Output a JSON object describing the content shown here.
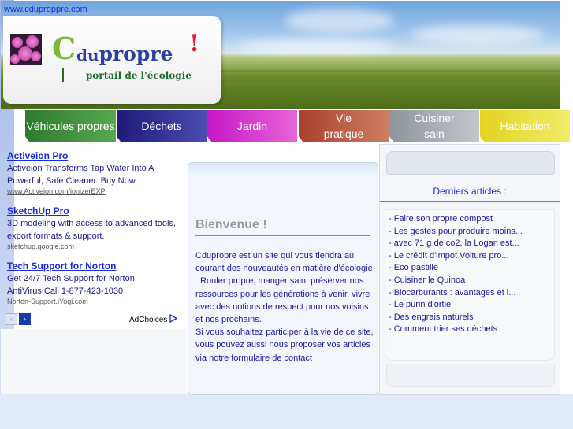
{
  "site_url": "www.cduproppre.com",
  "logo": {
    "c": "C",
    "du": "du",
    "propre": "propre",
    "excl": "!",
    "tagline": "portail de l'écologie"
  },
  "nav": [
    {
      "label": "Véhicules propres",
      "color": "#3a8a3a"
    },
    {
      "label": "Déchets",
      "color": "#2a2a8a"
    },
    {
      "label": "Jardin",
      "color": "#c81fd0"
    },
    {
      "label": "Vie pratique",
      "color": "#b4503a"
    },
    {
      "label": "Cuisiner sain",
      "color": "#9aa0a8"
    },
    {
      "label": "Habitation",
      "color": "#e8dc2a"
    }
  ],
  "ads": [
    {
      "title": "Activeion Pro",
      "text": "Activeion Transforms Tap Water Into A Powerful, Safe Cleaner. Buy Now.",
      "url": "www.Activeion.com/ionizerEXP"
    },
    {
      "title": "SketchUp Pro",
      "text": "3D modeling with access to advanced tools, export formats & support.",
      "url": "sketchup.google.com"
    },
    {
      "title": "Tech Support for Norton",
      "text": "Get 24/7 Tech Support for Norton AntiVirus,Call 1-877-423-1030",
      "url": "Norton-Support.iYogi.com"
    }
  ],
  "ad_choices": "AdChoices",
  "ad_nav": {
    "prev": "‹",
    "next": "›"
  },
  "welcome": {
    "title": "Bienvenue !",
    "intro_1": "Cdupropre est un site qui vous tiendra au courant des nouveautés en matière d'écologie : Rouler propre, manger sain, préserver nos ressources pour les générations à venir, vivre avec des notions de respect pour nos voisins et nos prochains.",
    "intro_2": "Si vous souhaitez participer à la vie de ce site, vous pouvez aussi nous proposer vos articles via notre formulaire de contact"
  },
  "recent": {
    "title": "Derniers articles :",
    "items": [
      "- Faire son propre compost",
      "- Les gestes pour produire moins...",
      "- avec 71 g de co2, la Logan est...",
      "- Le crédit d'impot Voiture pro...",
      "- Eco pastille",
      "- Cuisiner le Quinoa",
      "- Biocarburants : avantages et i...",
      "- Le purin d'ortie",
      "- Des engrais naturels",
      "- Comment trier ses déchets"
    ]
  }
}
